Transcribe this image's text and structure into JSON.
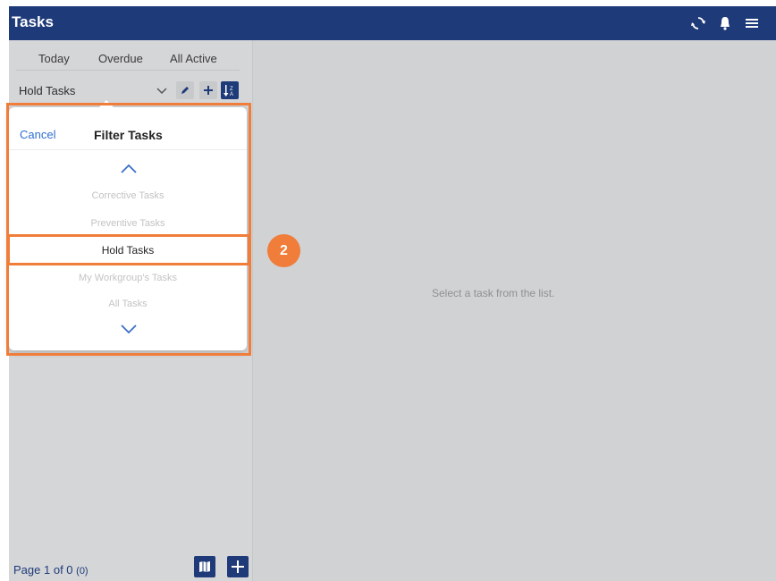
{
  "header": {
    "title": "Tasks",
    "icons": [
      "sync-icon",
      "bell-icon",
      "menu-icon"
    ]
  },
  "tabs": [
    {
      "label": "Today"
    },
    {
      "label": "Overdue"
    },
    {
      "label": "All Active"
    }
  ],
  "filter": {
    "current": "Hold Tasks"
  },
  "popover": {
    "cancel_label": "Cancel",
    "title": "Filter Tasks",
    "options": [
      {
        "label": "Corrective Tasks"
      },
      {
        "label": "Preventive Tasks"
      },
      {
        "label": "Hold Tasks",
        "selected": true
      },
      {
        "label": "My Workgroup's Tasks"
      },
      {
        "label": "All Tasks"
      }
    ]
  },
  "footer": {
    "page_word": "Page",
    "page_info": "1 of 0",
    "count": "(0)"
  },
  "main": {
    "empty_message": "Select a task from the list."
  },
  "annotation": {
    "step": "2"
  },
  "colors": {
    "brand": "#1e3a78",
    "highlight": "#f07d3a",
    "link": "#2f6fd0"
  }
}
